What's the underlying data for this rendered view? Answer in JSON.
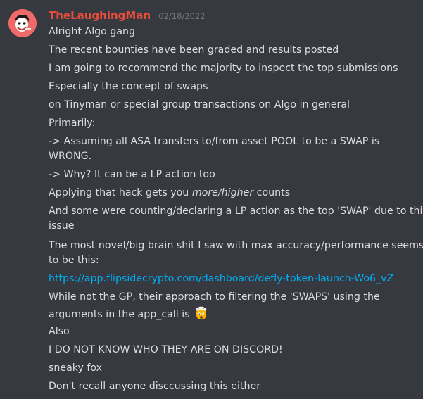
{
  "message": {
    "username": "TheLaughingMan",
    "timestamp": "02/18/2022",
    "username_color": "#e74c3c",
    "avatar_icon": "joker-avatar",
    "lines": {
      "l1": "Alright Algo gang",
      "l2": "The recent bounties have been graded and results posted",
      "l3": "I am going to recommend the majority to inspect the top submissions",
      "l4": "Especially the concept of swaps",
      "l5": "on Tinyman or special group transactions on Algo in general",
      "l6": "Primarily:",
      "l7a": "-> Assuming all ASA transfers to/from asset POOL to be a SWAP is",
      "l7b": "WRONG.",
      "l8": "-> Why? It can be a LP action too",
      "l9_pre": "Applying that hack gets you ",
      "l9_em": "more/higher",
      "l9_post": " counts",
      "l10a": "And some were counting/declaring a LP action as the top 'SWAP' due to this",
      "l10b": "issue",
      "l11a": "The most novel/big brain shit I saw with max accuracy/performance seems",
      "l11b": "to be this:",
      "l12_link": "https://app.flipsidecrypto.com/dashboard/defly-token-launch-Wo6_vZ",
      "l13a": "While not the GP, their approach to filtering the 'SWAPS' using the",
      "l13b": "arguments in the app_call is ",
      "l13_emoji": "exploding-head-emoji",
      "l14": "Also",
      "l15": "I DO NOT KNOW WHO THEY ARE ON DISCORD!",
      "l16": "sneaky fox",
      "l17": "Don't recall anyone disccussing this either"
    },
    "link_color": "#00aff4"
  }
}
